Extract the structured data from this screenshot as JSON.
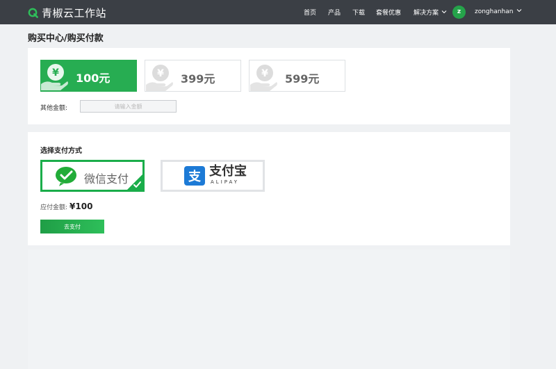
{
  "brand": {
    "name": "青椒云工作站",
    "logo_icon": "q-logo-icon",
    "color": "#2ebf5a"
  },
  "nav": {
    "items": [
      {
        "label": "首页"
      },
      {
        "label": "产品"
      },
      {
        "label": "下载"
      },
      {
        "label": "套餐优惠"
      },
      {
        "label": "解决方案",
        "dropdown": true
      }
    ],
    "user": {
      "avatar_letter": "z",
      "name": "zonghanhan"
    }
  },
  "breadcrumb": "购买中心/购买付款",
  "amounts": {
    "options": [
      {
        "label": "100元",
        "selected": true
      },
      {
        "label": "399元",
        "selected": false
      },
      {
        "label": "599元",
        "selected": false
      }
    ],
    "other_label": "其他金额:",
    "other_placeholder": "请输入金额"
  },
  "payment": {
    "title": "选择支付方式",
    "methods": [
      {
        "label": "微信支付",
        "icon": "wechat-pay-icon",
        "selected": true
      },
      {
        "label": "支付宝",
        "sub_label": "ALIPAY",
        "icon": "alipay-icon",
        "selected": false
      }
    ],
    "due_label": "应付金额:",
    "due_value": "¥100",
    "pay_button": "去支付"
  },
  "colors": {
    "accent": "#27ad52",
    "nav_bg": "#3b3f45",
    "alipay_blue": "#1c7ad6"
  }
}
